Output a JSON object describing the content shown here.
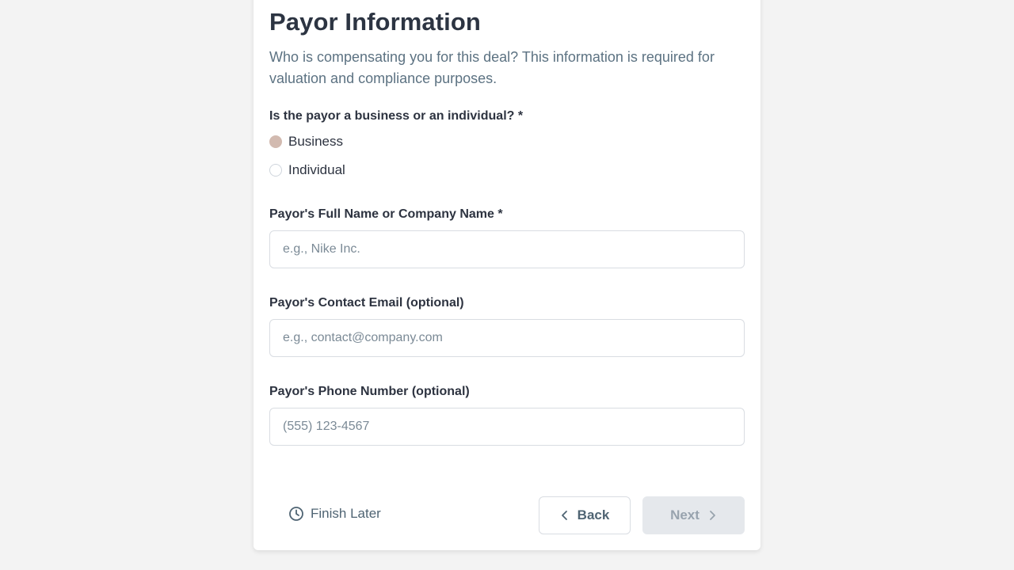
{
  "form": {
    "title": "Payor Information",
    "subtitle": "Who is compensating you for this deal? This information is required for valuation and compliance purposes.",
    "payor_type": {
      "label": "Is the payor a business or an individual? *",
      "options": [
        {
          "label": "Business",
          "selected": true
        },
        {
          "label": "Individual",
          "selected": false
        }
      ]
    },
    "name_field": {
      "label": "Payor's Full Name or Company Name *",
      "value": "",
      "placeholder": "e.g., Nike Inc."
    },
    "email_field": {
      "label": "Payor's Contact Email (optional)",
      "value": "",
      "placeholder": "e.g., contact@company.com"
    },
    "phone_field": {
      "label": "Payor's Phone Number (optional)",
      "value": "",
      "placeholder": "(555) 123-4567"
    }
  },
  "footer": {
    "finish_later_label": "Finish Later",
    "finish_later_icon": "clock-icon",
    "back_label": "Back",
    "back_icon": "chevron-left-icon",
    "next_label": "Next",
    "next_icon": "chevron-right-icon",
    "next_disabled": true
  },
  "colors": {
    "selected_radio": "#d2bab0",
    "next_disabled_bg": "#e5e8ec",
    "page_bg": "#f3f3f3"
  }
}
